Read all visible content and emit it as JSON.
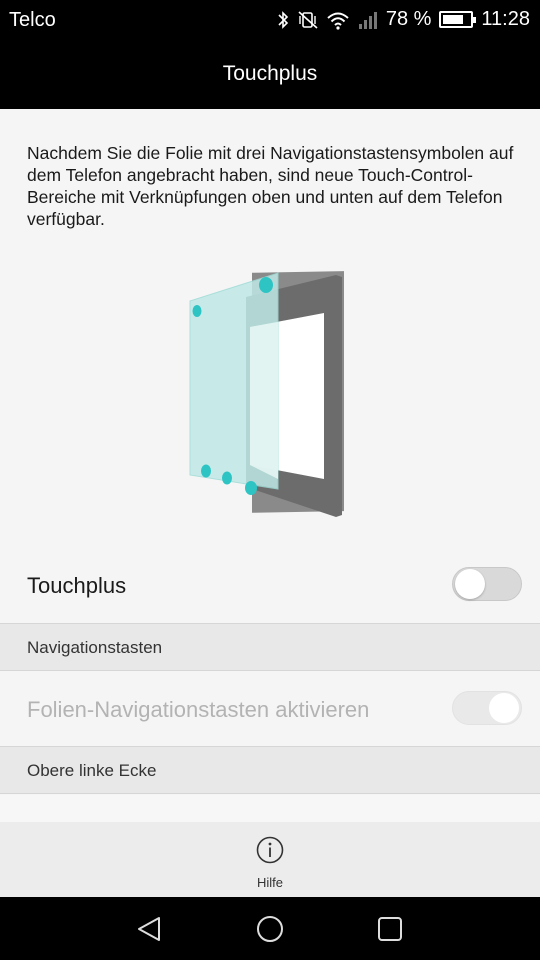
{
  "status_bar": {
    "carrier": "Telco",
    "battery_percent": "78 %",
    "battery_level": 0.78,
    "time": "11:28",
    "icons": [
      "bluetooth-icon",
      "mute-vibrate-icon",
      "wifi-icon",
      "signal-icon",
      "battery-icon"
    ]
  },
  "header": {
    "title": "Touchplus"
  },
  "main": {
    "description": "Nachdem Sie die Folie mit drei Navigationstastensymbolen auf dem Telefon angebracht haben, sind neue Touch-Control-Bereiche mit Verknüpfungen oben und unten auf dem Telefon verfügbar.",
    "touchplus": {
      "label": "Touchplus",
      "enabled": false
    },
    "sections": [
      {
        "header": "Navigationstasten",
        "items": [
          {
            "label": "Folien-Navigationstasten aktivieren",
            "enabled": true,
            "disabled": true
          }
        ]
      },
      {
        "header": "Obere linke Ecke",
        "items": []
      }
    ]
  },
  "bottom_bar": {
    "help_label": "Hilfe",
    "help_icon": "info-icon"
  },
  "nav_bar": {
    "icons": [
      "back-icon",
      "home-icon",
      "recent-apps-icon"
    ]
  },
  "colors": {
    "accent_teal": "#2ec4c4",
    "film_tint": "#bfe9e6",
    "phone_frame": "#666666"
  }
}
